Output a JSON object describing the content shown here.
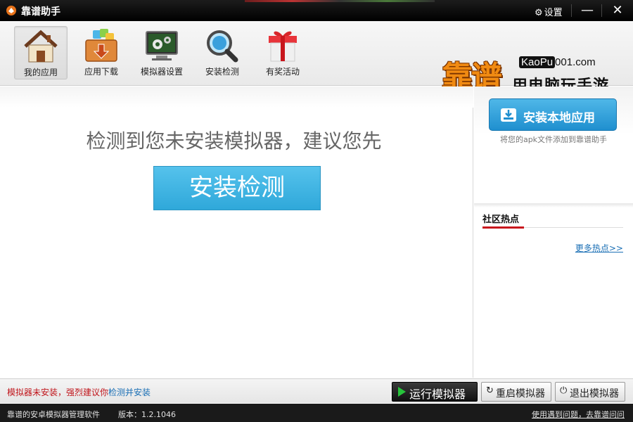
{
  "window": {
    "title": "靠谱助手",
    "settings_label": "设置",
    "minimize_glyph": "—",
    "close_glyph": "✕",
    "settings_icon": "gear-icon"
  },
  "toolbar": {
    "items": [
      {
        "label": "我的应用",
        "icon": "house-icon",
        "active": true
      },
      {
        "label": "应用下载",
        "icon": "download-box-icon",
        "active": false
      },
      {
        "label": "模拟器设置",
        "icon": "monitor-gears-icon",
        "active": false
      },
      {
        "label": "安装检测",
        "icon": "magnifier-icon",
        "active": false
      },
      {
        "label": "有奖活动",
        "icon": "gift-icon",
        "active": false
      }
    ]
  },
  "brand": {
    "chinese_name": "靠谱",
    "url_part1": "KaoPu",
    "url_part2": "001.com",
    "slogan": "用电脑玩手游"
  },
  "main": {
    "message": "检测到您未安装模拟器，建议您先",
    "detect_button": "安装检测"
  },
  "side": {
    "install_local_button": "安装本地应用",
    "install_hint": "将您的apk文件添加到靠谱助手",
    "hot_title": "社区热点",
    "more_hot": "更多热点>>"
  },
  "actionbar": {
    "warning": "模拟器未安装，强烈建议你",
    "warning_link": "检测并安装",
    "run_button": "运行模拟器",
    "restart_button": "重启模拟器",
    "exit_button": "退出模拟器"
  },
  "statusbar": {
    "app_desc": "靠谱的安卓模拟器管理软件",
    "version": "版本：1.2.1046",
    "help_link": "使用遇到问题，去靠谱问问"
  },
  "colors": {
    "accent_blue": "#2fa8da",
    "brand_orange": "#f08a12",
    "warning_red": "#c0141a",
    "hot_underline_red": "#c8161d",
    "play_green": "#27c43b"
  }
}
